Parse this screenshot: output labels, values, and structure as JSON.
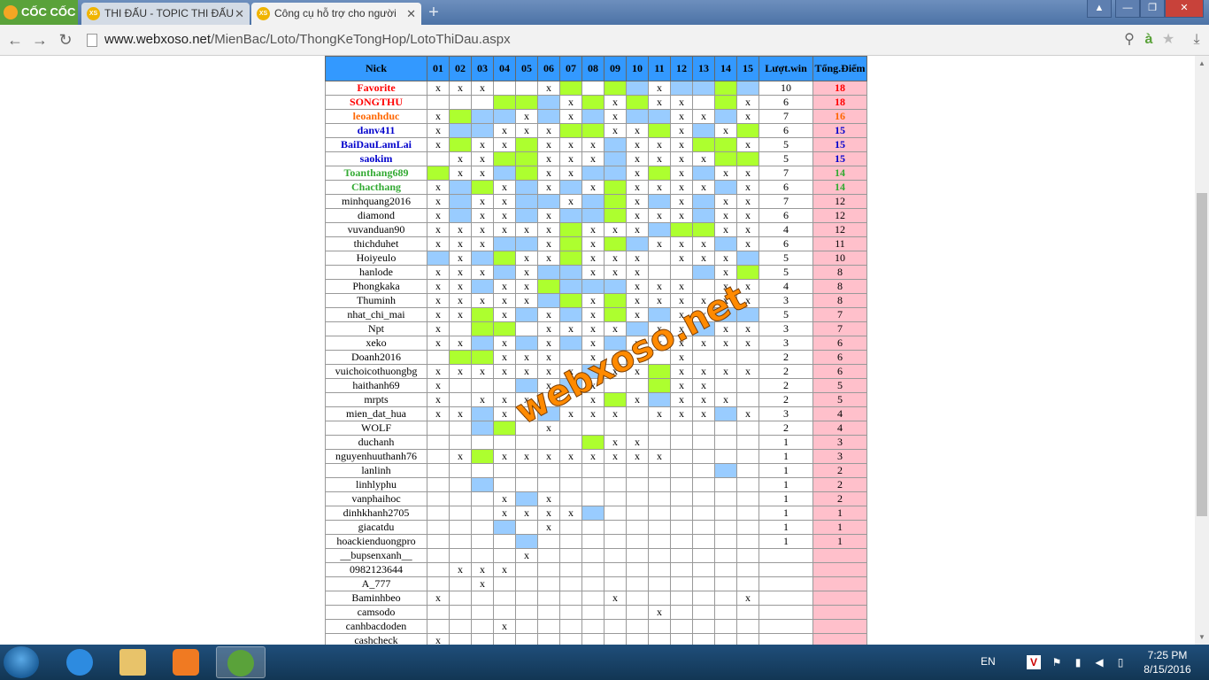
{
  "browser": {
    "brand": "CỐC CỐC",
    "tabs": [
      {
        "title": "THI ĐẤU - TOPIC THI ĐẤU",
        "favicon": "XS",
        "active": false
      },
      {
        "title": "Công cụ hỗ trợ cho người",
        "favicon": "XS",
        "active": true
      }
    ],
    "new_tab": "+",
    "url_host": "www.webxoso.net",
    "url_path": "/MienBac/Loto/ThongKeTongHop/LotoThiDau.aspx"
  },
  "table": {
    "headers": {
      "nick": "Nick",
      "days": [
        "01",
        "02",
        "03",
        "04",
        "05",
        "06",
        "07",
        "08",
        "09",
        "10",
        "11",
        "12",
        "13",
        "14",
        "15"
      ],
      "wins": "Lượt.win",
      "points": "Tổng.Điểm"
    },
    "rows": [
      {
        "nick": "Favorite",
        "cells": "xxx..xg.gbxbbgb",
        "wins": "10",
        "points": "18",
        "color": "#ff0000",
        "bold": true
      },
      {
        "nick": "SONGTHU",
        "cells": "...ggbxgxgxx.gx",
        "wins": "6",
        "points": "18",
        "color": "#ff0000",
        "bold": true
      },
      {
        "nick": "leoanhduc",
        "cells": "xgbbxbxbxbbxxbx",
        "wins": "7",
        "points": "16",
        "color": "#ff6600",
        "bold": true
      },
      {
        "nick": "danv411",
        "cells": "xbbxxxggxxgxbxg",
        "wins": "6",
        "points": "15",
        "color": "#0000cc",
        "bold": true
      },
      {
        "nick": "BaiDauLamLai",
        "cells": "xgxxgxxxbxxxggx",
        "wins": "5",
        "points": "15",
        "color": "#0000cc",
        "bold": true
      },
      {
        "nick": "saokim",
        "cells": ".xxggxxxbxxxxgg",
        "wins": "5",
        "points": "15",
        "color": "#0000cc",
        "bold": true
      },
      {
        "nick": "Toanthang689",
        "cells": "gxxbgxxbbxgxbxx",
        "wins": "7",
        "points": "14",
        "color": "#33aa33",
        "bold": true
      },
      {
        "nick": "Chacthang",
        "cells": "xbgxbxbxgxxxxbx",
        "wins": "6",
        "points": "14",
        "color": "#33aa33",
        "bold": true
      },
      {
        "nick": "minhquang2016",
        "cells": "xbxxbbxbgxbxbxx",
        "wins": "7",
        "points": "12",
        "color": "#000000",
        "bold": false
      },
      {
        "nick": "diamond",
        "cells": "xbxxbxbbgxxxbxx",
        "wins": "6",
        "points": "12",
        "color": "#000000",
        "bold": false
      },
      {
        "nick": "vuvanduan90",
        "cells": "xxxxxxgxxxbggxx",
        "wins": "4",
        "points": "12",
        "color": "#000000",
        "bold": false
      },
      {
        "nick": "thichduhet",
        "cells": "xxxbbxgxgbxxxbx",
        "wins": "6",
        "points": "11",
        "color": "#000000",
        "bold": false
      },
      {
        "nick": "Hoiyeulo",
        "cells": "bxbgxxgxxx.xxxb",
        "wins": "5",
        "points": "10",
        "color": "#000000",
        "bold": false
      },
      {
        "nick": "hanlode",
        "cells": "xxxbxbbxxx..bxg",
        "wins": "5",
        "points": "8",
        "color": "#000000",
        "bold": false
      },
      {
        "nick": "Phongkaka",
        "cells": "xxbxxgbbbxxx.xx",
        "wins": "4",
        "points": "8",
        "color": "#000000",
        "bold": false
      },
      {
        "nick": "Thuminh",
        "cells": "xxxxxbgxgxxxxxx",
        "wins": "3",
        "points": "8",
        "color": "#000000",
        "bold": false
      },
      {
        "nick": "nhat_chi_mai",
        "cells": "xxgxbxbxgxbxxbb",
        "wins": "5",
        "points": "7",
        "color": "#000000",
        "bold": false
      },
      {
        "nick": "Npt",
        "cells": "x.gg.xxxxbxxbxx",
        "wins": "3",
        "points": "7",
        "color": "#000000",
        "bold": false
      },
      {
        "nick": "xeko",
        "cells": "xxbxbxbxbxxxxxx",
        "wins": "3",
        "points": "6",
        "color": "#000000",
        "bold": false
      },
      {
        "nick": "Doanh2016",
        "cells": ".ggxxx.xx..x...",
        "wins": "2",
        "points": "6",
        "color": "#000000",
        "bold": false
      },
      {
        "nick": "vuichoicothuongbg",
        "cells": "xxxxxxxbxxgxxxx",
        "wins": "2",
        "points": "6",
        "color": "#000000",
        "bold": false
      },
      {
        "nick": "haithanh69",
        "cells": "x...bxbx..gxx..",
        "wins": "2",
        "points": "5",
        "color": "#000000",
        "bold": false
      },
      {
        "nick": "mrpts",
        "cells": "x.xxx..xgxbxxx.",
        "wins": "2",
        "points": "5",
        "color": "#000000",
        "bold": false
      },
      {
        "nick": "mien_dat_hua",
        "cells": "xxbxxbxxx.xxxbx",
        "wins": "3",
        "points": "4",
        "color": "#000000",
        "bold": false
      },
      {
        "nick": "WOLF",
        "cells": "..bg.x.........",
        "wins": "2",
        "points": "4",
        "color": "#000000",
        "bold": false
      },
      {
        "nick": "duchanh",
        "cells": ".......gxx.....",
        "wins": "1",
        "points": "3",
        "color": "#000000",
        "bold": false
      },
      {
        "nick": "nguyenhuuthanh76",
        "cells": ".xgxxxxxxxx....",
        "wins": "1",
        "points": "3",
        "color": "#000000",
        "bold": false
      },
      {
        "nick": "lanlinh",
        "cells": ".............b.",
        "wins": "1",
        "points": "2",
        "color": "#000000",
        "bold": false
      },
      {
        "nick": "linhlyphu",
        "cells": "..b............",
        "wins": "1",
        "points": "2",
        "color": "#000000",
        "bold": false
      },
      {
        "nick": "vanphaihoc",
        "cells": "...xbx.........",
        "wins": "1",
        "points": "2",
        "color": "#000000",
        "bold": false
      },
      {
        "nick": "dinhkhanh2705",
        "cells": "...xxxxb.......",
        "wins": "1",
        "points": "1",
        "color": "#000000",
        "bold": false
      },
      {
        "nick": "giacatdu",
        "cells": "...b.x.........",
        "wins": "1",
        "points": "1",
        "color": "#000000",
        "bold": false
      },
      {
        "nick": "hoackienduongpro",
        "cells": "....b..........",
        "wins": "1",
        "points": "1",
        "color": "#000000",
        "bold": false
      },
      {
        "nick": "__bupsenxanh__",
        "cells": "....x..........",
        "wins": "",
        "points": "",
        "color": "#000000",
        "bold": false
      },
      {
        "nick": "0982123644",
        "cells": ".xxx...........",
        "wins": "",
        "points": "",
        "color": "#000000",
        "bold": false
      },
      {
        "nick": "A_777",
        "cells": "..x............",
        "wins": "",
        "points": "",
        "color": "#000000",
        "bold": false
      },
      {
        "nick": "Baminhbeo",
        "cells": "x.......x.....x",
        "wins": "",
        "points": "",
        "color": "#000000",
        "bold": false
      },
      {
        "nick": "camsodo",
        "cells": "..........x....",
        "wins": "",
        "points": "",
        "color": "#000000",
        "bold": false
      },
      {
        "nick": "canhbacdoden",
        "cells": "...x...........",
        "wins": "",
        "points": "",
        "color": "#000000",
        "bold": false
      },
      {
        "nick": "cashcheck",
        "cells": "x..............",
        "wins": "",
        "points": "",
        "color": "#000000",
        "bold": false
      }
    ]
  },
  "watermark": "webxoso.net",
  "taskbar": {
    "lang": "EN",
    "time": "7:25 PM",
    "date": "8/15/2016"
  }
}
